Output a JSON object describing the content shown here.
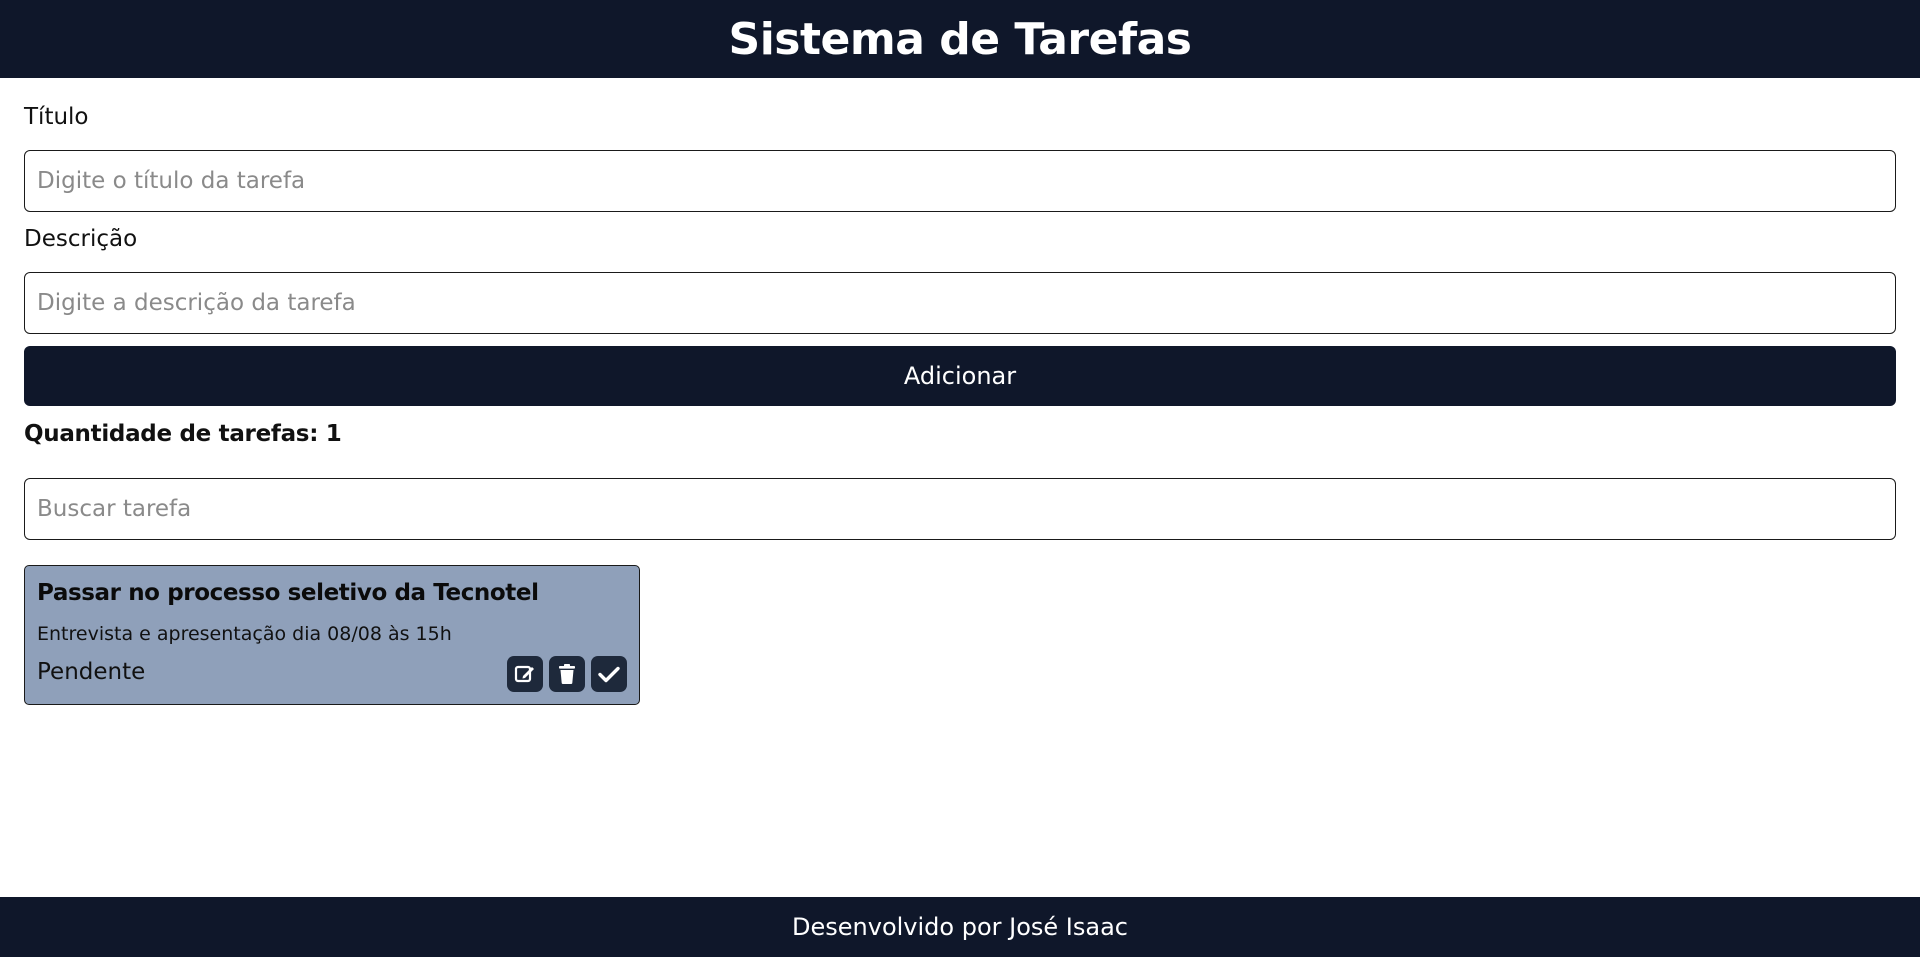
{
  "header": {
    "title": "Sistema de Tarefas"
  },
  "form": {
    "title_label": "Título",
    "title_placeholder": "Digite o título da tarefa",
    "title_value": "",
    "description_label": "Descrição",
    "description_placeholder": "Digite a descrição da tarefa",
    "description_value": "",
    "add_button_label": "Adicionar"
  },
  "summary": {
    "task_count_text": "Quantidade de tarefas: 1"
  },
  "search": {
    "placeholder": "Buscar tarefa",
    "value": ""
  },
  "tasks": [
    {
      "title": "Passar no processo seletivo da Tecnotel",
      "description": "Entrevista e apresentação dia 08/08 às 15h",
      "status": "Pendente",
      "actions": [
        "edit-icon",
        "trash-icon",
        "check-icon"
      ]
    }
  ],
  "footer": {
    "credit": "Desenvolvido por José Isaac"
  },
  "colors": {
    "header_bg": "#0f172a",
    "button_bg": "#0f172a",
    "card_bg": "#8fa0ba",
    "icon_button_bg": "#1e293b",
    "footer_bg": "#0f172a"
  }
}
